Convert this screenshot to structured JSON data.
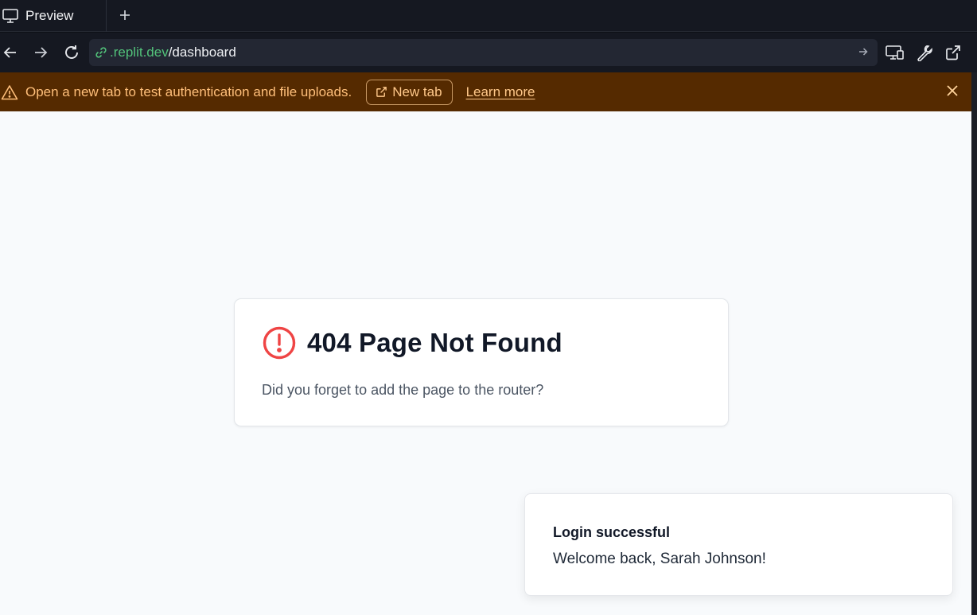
{
  "tabbar": {
    "tab_label": "Preview",
    "tab_icon": "monitor-icon",
    "new_tab_icon": "plus-icon"
  },
  "navbar": {
    "url_domain": ".replit.dev",
    "url_path": "/dashboard",
    "back_icon": "arrow-left-icon",
    "forward_icon": "arrow-right-icon",
    "reload_icon": "reload-icon",
    "devices_icon": "devices-icon",
    "devtools_icon": "wrench-icon",
    "external_icon": "external-link-icon"
  },
  "banner": {
    "message": "Open a new tab to test authentication and file uploads.",
    "new_tab_label": "New tab",
    "learn_more_label": "Learn more",
    "background": "#552a00",
    "text_color": "#ffbf7a"
  },
  "error_card": {
    "title": "404 Page Not Found",
    "message": "Did you forget to add the page to the router?",
    "icon_color": "#ef4444"
  },
  "toast": {
    "title": "Login successful",
    "message": "Welcome back, Sarah Johnson!"
  }
}
